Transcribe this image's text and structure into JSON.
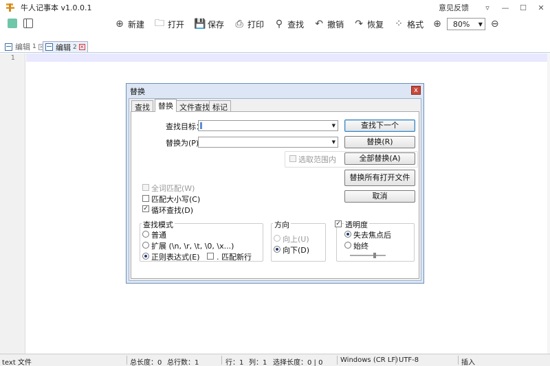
{
  "app": {
    "title": "牛人记事本 v1.0.0.1",
    "feedback": "意见反馈"
  },
  "window_buttons": {
    "menu": "▿",
    "minimize": "—",
    "maximize": "☐",
    "close": "✕"
  },
  "toolbar": {
    "items": [
      {
        "id": "new",
        "label": "新建",
        "icon": "⊕"
      },
      {
        "id": "open",
        "label": "打开",
        "icon": "🗀"
      },
      {
        "id": "save",
        "label": "保存",
        "icon": "💾"
      },
      {
        "id": "print",
        "label": "打印",
        "icon": "⎙"
      },
      {
        "id": "find",
        "label": "查找",
        "icon": "⚲"
      },
      {
        "id": "undo",
        "label": "撤销",
        "icon": "↶"
      },
      {
        "id": "redo",
        "label": "恢复",
        "icon": "↷"
      },
      {
        "id": "format",
        "label": "格式",
        "icon": "⁘"
      }
    ],
    "zoom_in_icon": "⊕",
    "zoom_out_icon": "⊖",
    "zoom_value": "80%"
  },
  "tabs": [
    {
      "label": "编辑",
      "num": "1",
      "active": false
    },
    {
      "label": "编辑",
      "num": "2",
      "active": true
    }
  ],
  "editor": {
    "line_numbers": [
      "1"
    ]
  },
  "dialog": {
    "title": "替换",
    "close": "x",
    "tabs": [
      "查找",
      "替换",
      "文件查找",
      "标记"
    ],
    "active_tab": "替换",
    "find_label": "查找目标：",
    "find_value": "",
    "replace_label": "替换为(P)：",
    "replace_value": "",
    "in_selection": "选取范围内",
    "buttons": {
      "find_next": "查找下一个",
      "replace": "替换(R)",
      "replace_all": "全部替换(A)",
      "replace_all_open": "替换所有打开文件",
      "cancel": "取消"
    },
    "options": {
      "whole_word": "全词匹配(W)",
      "match_case": "匹配大小写(C)",
      "wrap": "循环查找(D)"
    },
    "search_mode": {
      "title": "查找模式",
      "normal": "普通",
      "extended": "扩展 (\\n, \\r, \\t, \\0, \\x...)",
      "regex": "正则表达式(E)",
      "dot_newline": ". 匹配新行"
    },
    "direction": {
      "title": "方向",
      "up": "向上(U)",
      "down": "向下(D)"
    },
    "transparency": {
      "title": "透明度",
      "lose_focus": "失去焦点后",
      "always": "始终"
    }
  },
  "statusbar": {
    "file_type": "text 文件",
    "length": "总长度：0",
    "lines": "总行数：1",
    "row": "行：1",
    "col": "列：1",
    "selection": "选择长度：0 | 0",
    "eol": "Windows (CR LF)",
    "encoding": "UTF-8",
    "mode": "插入"
  }
}
